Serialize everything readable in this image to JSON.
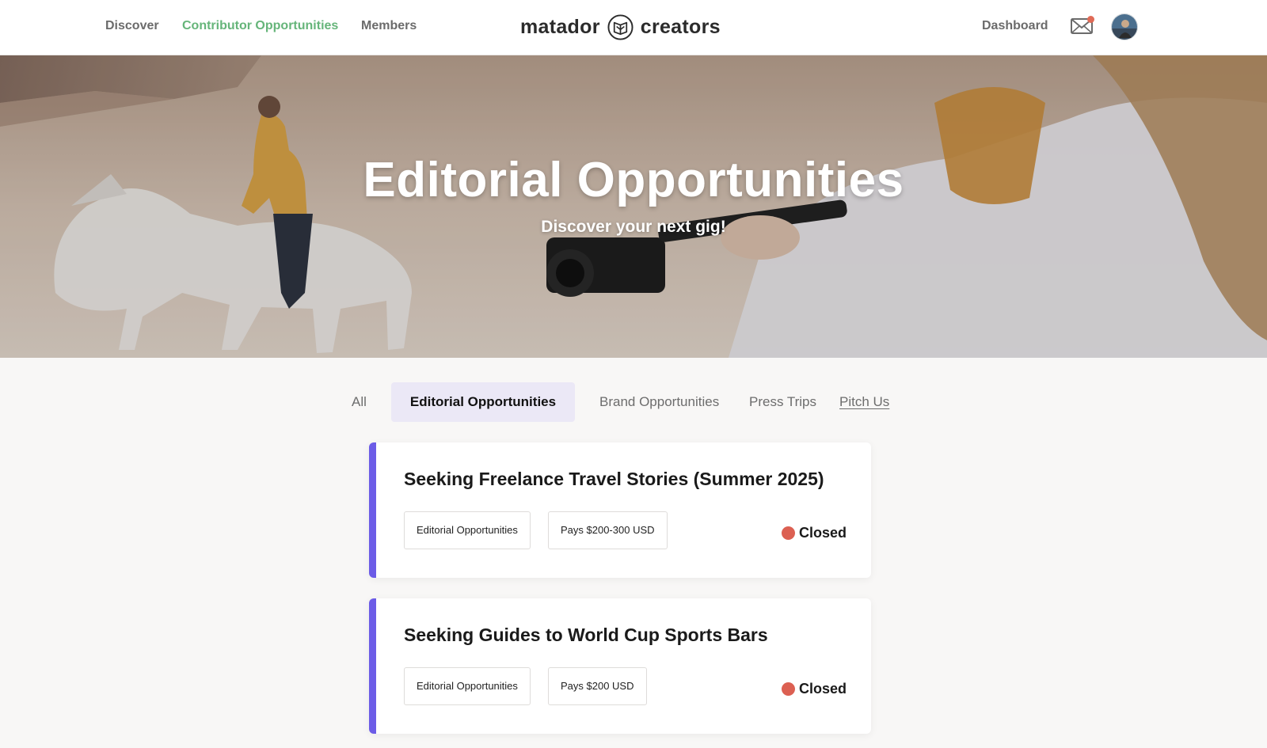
{
  "header": {
    "nav": [
      "Discover",
      "Contributor Opportunities",
      "Members"
    ],
    "logo_left": "matador",
    "logo_right": "creators",
    "dashboard": "Dashboard"
  },
  "hero": {
    "title": "Editorial Opportunities",
    "subtitle": "Discover your next gig!"
  },
  "tabs": [
    "All",
    "Editorial Opportunities",
    "Brand Opportunities",
    "Press Trips",
    "Pitch Us"
  ],
  "selected_tab": "Editorial Opportunities",
  "cards": [
    {
      "title": "Seeking Freelance Travel Stories (Summer 2025)",
      "tags": [
        "Editorial Opportunities",
        "Pays $200-300 USD"
      ],
      "status": "Closed"
    },
    {
      "title": "Seeking Guides to World Cup Sports Bars",
      "tags": [
        "Editorial Opportunities",
        "Pays $200 USD"
      ],
      "status": "Closed"
    }
  ],
  "colors": {
    "accent_green": "#66b57a",
    "card_bar": "#6c5ce7",
    "status_closed": "#dc6052",
    "tab_selected_bg": "#ebe8f6"
  }
}
